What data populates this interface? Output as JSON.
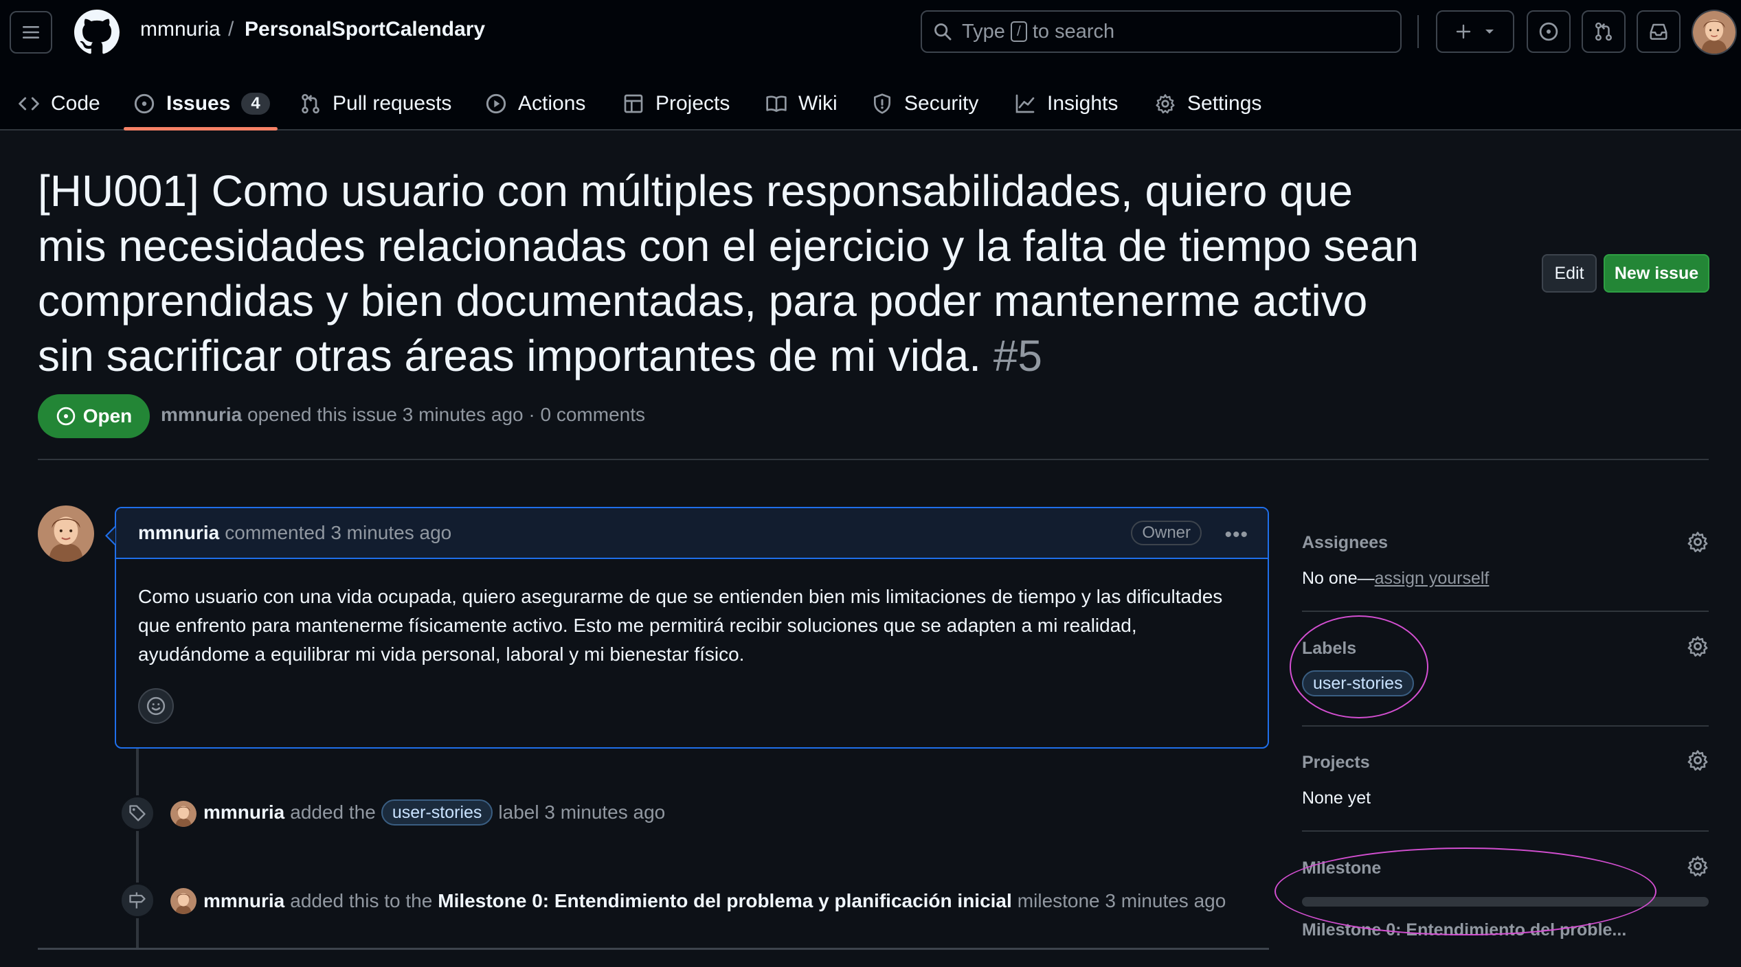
{
  "header": {
    "owner": "mmnuria",
    "separator": "/",
    "repo": "PersonalSportCalendary",
    "search_prefix": "Type",
    "search_key": "/",
    "search_suffix": "to search"
  },
  "tabs": [
    {
      "label": "Code",
      "icon": "code-icon"
    },
    {
      "label": "Issues",
      "icon": "issue-opened-icon",
      "count": "4",
      "active": true
    },
    {
      "label": "Pull requests",
      "icon": "git-pull-request-icon"
    },
    {
      "label": "Actions",
      "icon": "play-icon"
    },
    {
      "label": "Projects",
      "icon": "table-icon"
    },
    {
      "label": "Wiki",
      "icon": "book-icon"
    },
    {
      "label": "Security",
      "icon": "shield-icon"
    },
    {
      "label": "Insights",
      "icon": "graph-icon"
    },
    {
      "label": "Settings",
      "icon": "gear-icon"
    }
  ],
  "issue": {
    "title": "[HU001] Como usuario con múltiples responsabilidades, quiero que mis necesidades relacionadas con el ejercicio y la falta de tiempo sean comprendidas y bien documentadas, para poder mantenerme activo sin sacrificar otras áreas importantes de mi vida.",
    "number": "#5",
    "state": "Open",
    "author": "mmnuria",
    "meta": "opened this issue 3 minutes ago · 0 comments",
    "edit_label": "Edit",
    "new_issue_label": "New issue"
  },
  "comment": {
    "author": "mmnuria",
    "action": "commented 3 minutes ago",
    "badge": "Owner",
    "body": "Como usuario con una vida ocupada, quiero asegurarme de que se entienden bien mis limitaciones de tiempo y las dificultades que enfrento para mantenerme físicamente activo. Esto me permitirá recibir soluciones que se adapten a mi realidad, ayudándome a equilibrar mi vida personal, laboral y mi bienestar físico."
  },
  "timeline": [
    {
      "actor": "mmnuria",
      "before": "added the",
      "label": "user-stories",
      "after": "label 3 minutes ago"
    },
    {
      "actor": "mmnuria",
      "before": "added this to the",
      "milestone": "Milestone 0: Entendimiento del problema y planificación inicial",
      "after": "milestone 3 minutes ago"
    }
  ],
  "sidebar": {
    "assignees_title": "Assignees",
    "assignees_value": "No one—",
    "assign_yourself": "assign yourself",
    "labels_title": "Labels",
    "label": "user-stories",
    "projects_title": "Projects",
    "projects_value": "None yet",
    "milestone_title": "Milestone",
    "milestone_value": "Milestone 0: Entendimiento del proble...",
    "milestone_progress": 0
  },
  "colors": {
    "accent_green": "#238636",
    "underline": "#f78166",
    "annotation": "#d44fd2",
    "comment_border": "#1f6feb"
  }
}
